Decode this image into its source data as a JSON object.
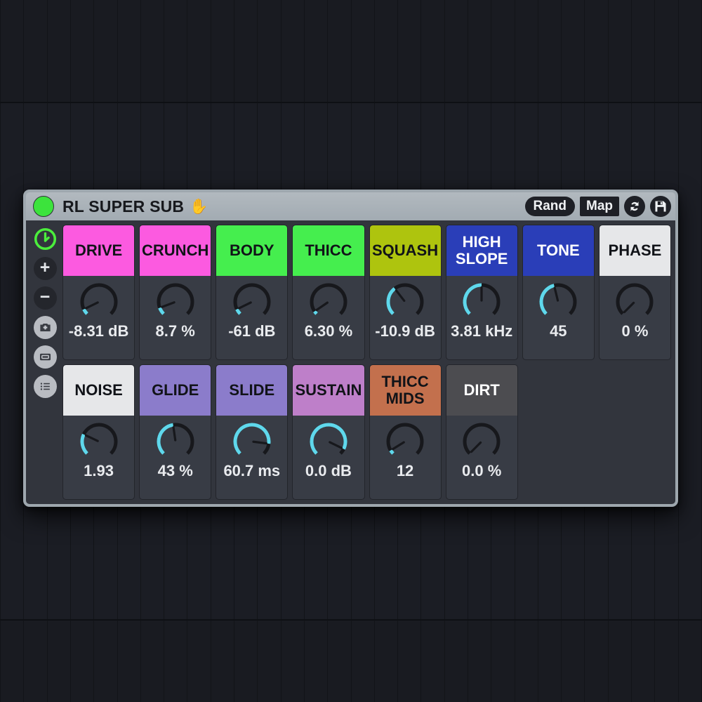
{
  "background": {
    "type": "ableton-session-grid",
    "base_color": "#191b21",
    "line_color": "#121418"
  },
  "titlebar": {
    "led_color": "#3ce33c",
    "title": "RL SUPER SUB",
    "hand_icon": "✋",
    "rand_label": "Rand",
    "map_label": "Map",
    "sync_icon": "sync-icon",
    "save_icon": "save-icon"
  },
  "sidebar": {
    "items": [
      {
        "name": "power-toggle-icon",
        "style": "power"
      },
      {
        "name": "add-icon",
        "style": "dark",
        "glyph": "+"
      },
      {
        "name": "remove-icon",
        "style": "dark",
        "glyph": "−"
      },
      {
        "name": "snapshot-camera-icon",
        "style": "light"
      },
      {
        "name": "card-icon",
        "style": "light"
      },
      {
        "name": "list-icon",
        "style": "light"
      }
    ]
  },
  "colors": {
    "accent_cyan": "#5fd8ec",
    "knob_track": "#17181c",
    "cell_bg": "#383c45",
    "panel_bg": "#32353d",
    "frame": "#9ea7ae"
  },
  "macros": [
    {
      "label": "DRIVE",
      "value": "-8.31 dB",
      "header_color": "#fc5ae0",
      "text_color": "#111318",
      "fill": 0.07,
      "pointer": 0.07
    },
    {
      "label": "CRUNCH",
      "value": "8.7 %",
      "header_color": "#fc5ae0",
      "text_color": "#111318",
      "fill": 0.09,
      "pointer": 0.09
    },
    {
      "label": "BODY",
      "value": "-61 dB",
      "header_color": "#45ee4e",
      "text_color": "#111318",
      "fill": 0.07,
      "pointer": 0.07
    },
    {
      "label": "THICC",
      "value": "6.30 %",
      "header_color": "#45ee4e",
      "text_color": "#111318",
      "fill": 0.04,
      "pointer": 0.04
    },
    {
      "label": "SQUASH",
      "value": "-10.9 dB",
      "header_color": "#aec40e",
      "text_color": "#111318",
      "fill": 0.36,
      "pointer": 0.36
    },
    {
      "label": "HIGH\nSLOPE",
      "value": "3.81 kHz",
      "header_color": "#2a3eb8",
      "text_color": "#ffffff",
      "fill": 0.5,
      "pointer": 0.5
    },
    {
      "label": "TONE",
      "value": "45",
      "header_color": "#2a3eb8",
      "text_color": "#ffffff",
      "fill": 0.45,
      "pointer": 0.45
    },
    {
      "label": "PHASE",
      "value": "0 %",
      "header_color": "#e6e7e9",
      "text_color": "#111318",
      "fill": 0.0,
      "pointer": 0.0
    },
    {
      "label": "NOISE",
      "value": "1.93",
      "header_color": "#e6e7e9",
      "text_color": "#111318",
      "fill": 0.26,
      "pointer": 0.26
    },
    {
      "label": "GLIDE",
      "value": "43 %",
      "header_color": "#8b7ccb",
      "text_color": "#111318",
      "fill": 0.47,
      "pointer": 0.47
    },
    {
      "label": "SLIDE",
      "value": "60.7 ms",
      "header_color": "#8b7ccb",
      "text_color": "#111318",
      "fill": 0.86,
      "pointer": 0.86
    },
    {
      "label": "SUSTAIN",
      "value": "0.0 dB",
      "header_color": "#be7fc9",
      "text_color": "#111318",
      "fill": 0.93,
      "pointer": 0.93
    },
    {
      "label": "THICC\nMIDS",
      "value": "12",
      "header_color": "#c3704d",
      "text_color": "#111318",
      "fill": 0.05,
      "pointer": 0.05
    },
    {
      "label": "DIRT",
      "value": "0.0 %",
      "header_color": "#4c4c50",
      "text_color": "#ffffff",
      "fill": 0.0,
      "pointer": 0.0
    }
  ]
}
